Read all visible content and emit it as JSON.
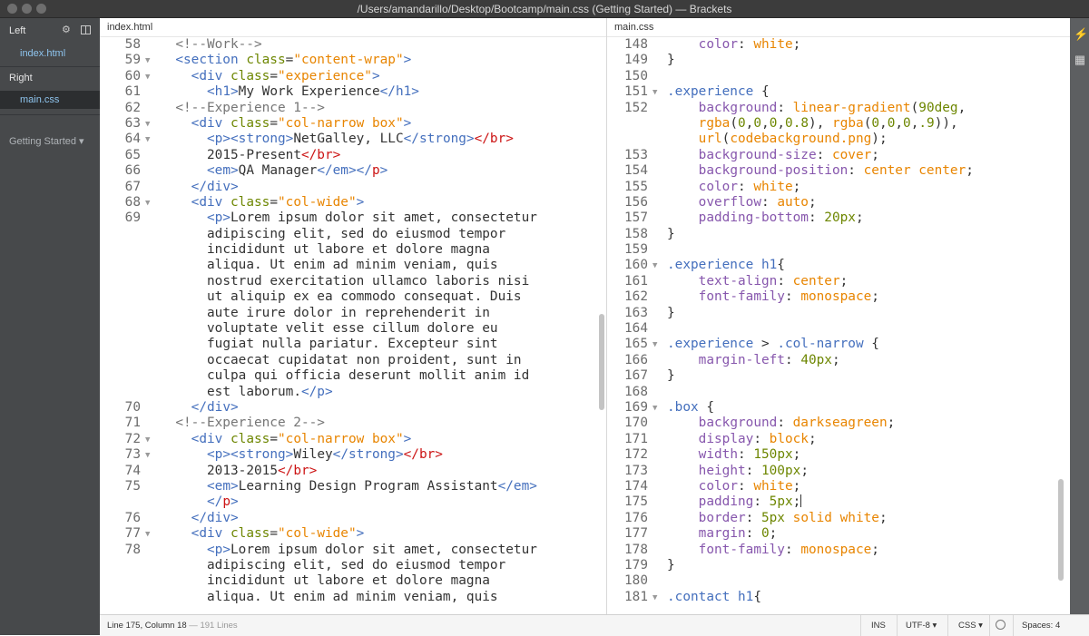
{
  "window": {
    "title": "/Users/amandarillo/Desktop/Bootcamp/main.css (Getting Started) — Brackets"
  },
  "sidebar": {
    "left_label": "Left",
    "left_file": "index.html",
    "right_label": "Right",
    "right_file": "main.css",
    "project": "Getting Started ▾",
    "icons": [
      "gear-icon",
      "split-view-icon"
    ]
  },
  "left_pane": {
    "filename": "index.html",
    "lines": [
      {
        "n": "58",
        "fold": "",
        "indent": 2,
        "html": "<span class=\"c-com\">&lt;!--Work--&gt;</span>"
      },
      {
        "n": "59",
        "fold": "▼",
        "indent": 2,
        "html": "<span class=\"c-tag\">&lt;section</span> <span class=\"c-attr\">class</span>=<span class=\"c-str\">\"content-wrap\"</span><span class=\"c-tag\">&gt;</span>"
      },
      {
        "n": "60",
        "fold": "▼",
        "indent": 4,
        "html": "<span class=\"c-tag\">&lt;div</span> <span class=\"c-attr\">class</span>=<span class=\"c-str\">\"experience\"</span><span class=\"c-tag\">&gt;</span>"
      },
      {
        "n": "61",
        "fold": "",
        "indent": 6,
        "html": "<span class=\"c-tag\">&lt;h1&gt;</span>My Work Experience<span class=\"c-tag\">&lt;/h1&gt;</span>"
      },
      {
        "n": "62",
        "fold": "",
        "indent": 2,
        "html": "<span class=\"c-com\">&lt;!--Experience 1--&gt;</span>"
      },
      {
        "n": "63",
        "fold": "▼",
        "indent": 4,
        "html": "<span class=\"c-tag\">&lt;div</span> <span class=\"c-attr\">class</span>=<span class=\"c-str\">\"col-narrow box\"</span><span class=\"c-tag\">&gt;</span>"
      },
      {
        "n": "64",
        "fold": "▼",
        "indent": 6,
        "html": "<span class=\"c-tag\">&lt;p&gt;&lt;strong&gt;</span>NetGalley, LLC<span class=\"c-tag\">&lt;/strong&gt;</span><span class=\"c-close\">&lt;/br&gt;</span>"
      },
      {
        "n": "65",
        "fold": "",
        "indent": 6,
        "html": "2015-Present<span class=\"c-close\">&lt;/br&gt;</span>"
      },
      {
        "n": "66",
        "fold": "",
        "indent": 6,
        "html": "<span class=\"c-tag\">&lt;em&gt;</span>QA Manager<span class=\"c-tag\">&lt;/em&gt;&lt;/</span><span class=\"c-close\">p</span><span class=\"c-tag\">&gt;</span>"
      },
      {
        "n": "67",
        "fold": "",
        "indent": 4,
        "html": "<span class=\"c-tag\">&lt;/div&gt;</span>"
      },
      {
        "n": "68",
        "fold": "▼",
        "indent": 4,
        "html": "<span class=\"c-tag\">&lt;div</span> <span class=\"c-attr\">class</span>=<span class=\"c-str\">\"col-wide\"</span><span class=\"c-tag\">&gt;</span>"
      },
      {
        "n": "69",
        "fold": "",
        "indent": 6,
        "html": "<span class=\"c-tag\">&lt;p&gt;</span>Lorem ipsum dolor sit amet, consectetur"
      },
      {
        "n": "",
        "fold": "",
        "indent": 6,
        "html": "adipiscing elit, sed do eiusmod tempor"
      },
      {
        "n": "",
        "fold": "",
        "indent": 6,
        "html": "incididunt ut labore et dolore magna"
      },
      {
        "n": "",
        "fold": "",
        "indent": 6,
        "html": "aliqua. Ut enim ad minim veniam, quis"
      },
      {
        "n": "",
        "fold": "",
        "indent": 6,
        "html": "nostrud exercitation ullamco laboris nisi"
      },
      {
        "n": "",
        "fold": "",
        "indent": 6,
        "html": "ut aliquip ex ea commodo consequat. Duis"
      },
      {
        "n": "",
        "fold": "",
        "indent": 6,
        "html": "aute irure dolor in reprehenderit in"
      },
      {
        "n": "",
        "fold": "",
        "indent": 6,
        "html": "voluptate velit esse cillum dolore eu"
      },
      {
        "n": "",
        "fold": "",
        "indent": 6,
        "html": "fugiat nulla pariatur. Excepteur sint"
      },
      {
        "n": "",
        "fold": "",
        "indent": 6,
        "html": "occaecat cupidatat non proident, sunt in"
      },
      {
        "n": "",
        "fold": "",
        "indent": 6,
        "html": "culpa qui officia deserunt mollit anim id"
      },
      {
        "n": "",
        "fold": "",
        "indent": 6,
        "html": "est laborum.<span class=\"c-tag\">&lt;/p&gt;</span>"
      },
      {
        "n": "70",
        "fold": "",
        "indent": 4,
        "html": "<span class=\"c-tag\">&lt;/div&gt;</span>"
      },
      {
        "n": "71",
        "fold": "",
        "indent": 2,
        "html": "<span class=\"c-com\">&lt;!--Experience 2--&gt;</span>"
      },
      {
        "n": "72",
        "fold": "▼",
        "indent": 4,
        "html": "<span class=\"c-tag\">&lt;div</span> <span class=\"c-attr\">class</span>=<span class=\"c-str\">\"col-narrow box\"</span><span class=\"c-tag\">&gt;</span>"
      },
      {
        "n": "73",
        "fold": "▼",
        "indent": 6,
        "html": "<span class=\"c-tag\">&lt;p&gt;&lt;strong&gt;</span>Wiley<span class=\"c-tag\">&lt;/strong&gt;</span><span class=\"c-close\">&lt;/br&gt;</span>"
      },
      {
        "n": "74",
        "fold": "",
        "indent": 6,
        "html": "2013-2015<span class=\"c-close\">&lt;/br&gt;</span>"
      },
      {
        "n": "75",
        "fold": "",
        "indent": 6,
        "html": "<span class=\"c-tag\">&lt;em&gt;</span>Learning Design Program Assistant<span class=\"c-tag\">&lt;/em&gt;</span>"
      },
      {
        "n": "",
        "fold": "",
        "indent": 6,
        "html": "<span class=\"c-tag\">&lt;/</span><span class=\"c-close\">p</span><span class=\"c-tag\">&gt;</span>"
      },
      {
        "n": "76",
        "fold": "",
        "indent": 4,
        "html": "<span class=\"c-tag\">&lt;/div&gt;</span>"
      },
      {
        "n": "77",
        "fold": "▼",
        "indent": 4,
        "html": "<span class=\"c-tag\">&lt;div</span> <span class=\"c-attr\">class</span>=<span class=\"c-str\">\"col-wide\"</span><span class=\"c-tag\">&gt;</span>"
      },
      {
        "n": "78",
        "fold": "",
        "indent": 6,
        "html": "<span class=\"c-tag\">&lt;p&gt;</span>Lorem ipsum dolor sit amet, consectetur"
      },
      {
        "n": "",
        "fold": "",
        "indent": 6,
        "html": "adipiscing elit, sed do eiusmod tempor"
      },
      {
        "n": "",
        "fold": "",
        "indent": 6,
        "html": "incididunt ut labore et dolore magna"
      },
      {
        "n": "",
        "fold": "",
        "indent": 6,
        "html": "aliqua. Ut enim ad minim veniam, quis"
      }
    ]
  },
  "right_pane": {
    "filename": "main.css",
    "lines": [
      {
        "n": "148",
        "fold": "",
        "indent": 4,
        "html": "<span class=\"c-prop\">color</span>: <span class=\"c-val\">white</span>;"
      },
      {
        "n": "149",
        "fold": "",
        "indent": 0,
        "html": "}"
      },
      {
        "n": "150",
        "fold": "",
        "indent": 0,
        "html": ""
      },
      {
        "n": "151",
        "fold": "▼",
        "indent": 0,
        "html": "<span class=\"c-sel\">.experience</span> {"
      },
      {
        "n": "152",
        "fold": "",
        "indent": 4,
        "html": "<span class=\"c-prop\">background</span>: <span class=\"c-val\">linear-gradient</span>(<span class=\"c-num\">90deg</span>,"
      },
      {
        "n": "",
        "fold": "",
        "indent": 4,
        "html": "<span class=\"c-val\">rgba</span>(<span class=\"c-num\">0</span>,<span class=\"c-num\">0</span>,<span class=\"c-num\">0</span>,<span class=\"c-num\">0.8</span>), <span class=\"c-val\">rgba</span>(<span class=\"c-num\">0</span>,<span class=\"c-num\">0</span>,<span class=\"c-num\">0</span>,<span class=\"c-num\">.9</span>)),"
      },
      {
        "n": "",
        "fold": "",
        "indent": 4,
        "html": "<span class=\"c-val\">url</span>(<span class=\"c-val\">codebackground.png</span>);"
      },
      {
        "n": "153",
        "fold": "",
        "indent": 4,
        "html": "<span class=\"c-prop\">background-size</span>: <span class=\"c-val\">cover</span>;"
      },
      {
        "n": "154",
        "fold": "",
        "indent": 4,
        "html": "<span class=\"c-prop\">background-position</span>: <span class=\"c-val\">center center</span>;"
      },
      {
        "n": "155",
        "fold": "",
        "indent": 4,
        "html": "<span class=\"c-prop\">color</span>: <span class=\"c-val\">white</span>;"
      },
      {
        "n": "156",
        "fold": "",
        "indent": 4,
        "html": "<span class=\"c-prop\">overflow</span>: <span class=\"c-val\">auto</span>;"
      },
      {
        "n": "157",
        "fold": "",
        "indent": 4,
        "html": "<span class=\"c-prop\">padding-bottom</span>: <span class=\"c-num\">20px</span>;"
      },
      {
        "n": "158",
        "fold": "",
        "indent": 0,
        "html": "}"
      },
      {
        "n": "159",
        "fold": "",
        "indent": 0,
        "html": ""
      },
      {
        "n": "160",
        "fold": "▼",
        "indent": 0,
        "html": "<span class=\"c-sel\">.experience h1</span>{"
      },
      {
        "n": "161",
        "fold": "",
        "indent": 4,
        "html": "<span class=\"c-prop\">text-align</span>: <span class=\"c-val\">center</span>;"
      },
      {
        "n": "162",
        "fold": "",
        "indent": 4,
        "html": "<span class=\"c-prop\">font-family</span>: <span class=\"c-val\">monospace</span>;"
      },
      {
        "n": "163",
        "fold": "",
        "indent": 0,
        "html": "}"
      },
      {
        "n": "164",
        "fold": "",
        "indent": 0,
        "html": ""
      },
      {
        "n": "165",
        "fold": "▼",
        "indent": 0,
        "html": "<span class=\"c-sel\">.experience</span> &gt; <span class=\"c-sel\">.col-narrow</span> {"
      },
      {
        "n": "166",
        "fold": "",
        "indent": 4,
        "html": "<span class=\"c-prop\">margin-left</span>: <span class=\"c-num\">40px</span>;"
      },
      {
        "n": "167",
        "fold": "",
        "indent": 0,
        "html": "}"
      },
      {
        "n": "168",
        "fold": "",
        "indent": 0,
        "html": ""
      },
      {
        "n": "169",
        "fold": "▼",
        "indent": 0,
        "html": "<span class=\"c-sel\">.box</span> {"
      },
      {
        "n": "170",
        "fold": "",
        "indent": 4,
        "html": "<span class=\"c-prop\">background</span>: <span class=\"c-val\">darkseagreen</span>;"
      },
      {
        "n": "171",
        "fold": "",
        "indent": 4,
        "html": "<span class=\"c-prop\">display</span>: <span class=\"c-val\">block</span>;"
      },
      {
        "n": "172",
        "fold": "",
        "indent": 4,
        "html": "<span class=\"c-prop\">width</span>: <span class=\"c-num\">150px</span>;"
      },
      {
        "n": "173",
        "fold": "",
        "indent": 4,
        "html": "<span class=\"c-prop\">height</span>: <span class=\"c-num\">100px</span>;"
      },
      {
        "n": "174",
        "fold": "",
        "indent": 4,
        "html": "<span class=\"c-prop\">color</span>: <span class=\"c-val\">white</span>;"
      },
      {
        "n": "175",
        "fold": "",
        "indent": 4,
        "html": "<span class=\"c-prop\">padding</span>: <span class=\"c-num\">5px</span>;<span class=\"cursor\"></span>"
      },
      {
        "n": "176",
        "fold": "",
        "indent": 4,
        "html": "<span class=\"c-prop\">border</span>: <span class=\"c-num\">5px</span> <span class=\"c-val\">solid white</span>;"
      },
      {
        "n": "177",
        "fold": "",
        "indent": 4,
        "html": "<span class=\"c-prop\">margin</span>: <span class=\"c-num\">0</span>;"
      },
      {
        "n": "178",
        "fold": "",
        "indent": 4,
        "html": "<span class=\"c-prop\">font-family</span>: <span class=\"c-val\">monospace</span>;"
      },
      {
        "n": "179",
        "fold": "",
        "indent": 0,
        "html": "}"
      },
      {
        "n": "180",
        "fold": "",
        "indent": 0,
        "html": ""
      },
      {
        "n": "181",
        "fold": "▼",
        "indent": 0,
        "html": "<span class=\"c-sel\">.contact h1</span>{"
      }
    ]
  },
  "status": {
    "position": "Line 175, Column 18",
    "lines": " — 191 Lines",
    "ins": "INS",
    "encoding": "UTF-8 ▾",
    "language": "CSS ▾",
    "spaces": "Spaces: 4"
  },
  "toolbar": {
    "icons": [
      "live-preview-icon",
      "extension-manager-icon"
    ]
  }
}
